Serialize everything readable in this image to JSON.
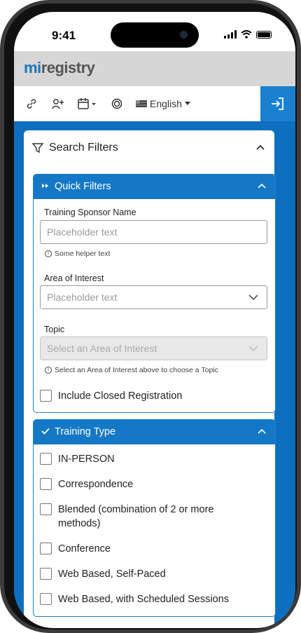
{
  "status": {
    "time": "9:41"
  },
  "brand": {
    "logo_mi": "mi",
    "logo_rest": "registry"
  },
  "toolbar": {
    "icons": [
      "link-icon",
      "add-user-icon",
      "calendar-icon",
      "badge-icon",
      "flag-icon"
    ],
    "language": "English",
    "login_icon": "login-icon"
  },
  "search_filters": {
    "title": "Search Filters",
    "quick_filters": {
      "title": "Quick Filters",
      "sponsor_label": "Training Sponsor Name",
      "sponsor_placeholder": "Placeholder text",
      "sponsor_helper": "Some helper text",
      "area_label": "Area of Interest",
      "area_placeholder": "Placeholder text",
      "topic_label": "Topic",
      "topic_placeholder": "Select an Area of Interest",
      "topic_helper": "Select an Area of Interest above to choose a Topic",
      "closed_label": "Include Closed Registration"
    },
    "training_type": {
      "title": "Training Type",
      "options": [
        "IN-PERSON",
        "Correspondence",
        "Blended (combination of 2 or more methods)",
        "Conference",
        "Web Based, Self-Paced",
        "Web Based, with Scheduled Sessions"
      ]
    }
  }
}
